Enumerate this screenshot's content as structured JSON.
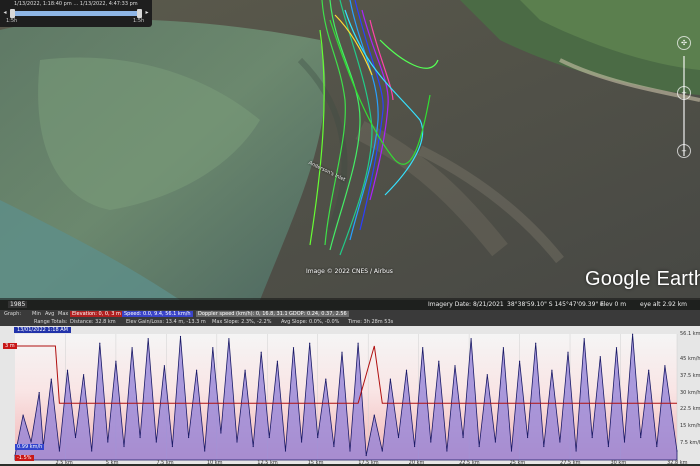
{
  "time_slider": {
    "range_text": "1/13/2022, 1:18:40 pm … 1/13/2022, 4:47:33 pm",
    "start_label": "1:5h",
    "end_label": "1:5h"
  },
  "map": {
    "river_label": "Anderson's Inlet",
    "copyright": "Image © 2022 CNES / Airbus",
    "logo_text": "Google Earth",
    "history_year": "1985"
  },
  "status_bar": {
    "imagery_date": "Imagery Date: 8/21/2021",
    "coords": "38°38'59.10\" S  145°47'09.39\" E",
    "elev": "elev   0 m",
    "eye_alt": "eye alt   2.92 km"
  },
  "profile": {
    "header_row1": {
      "graph": "Graph:",
      "min": "Min",
      "avg": "Avg",
      "max": "Max",
      "elevation": "Elevation: 0, 0, 3 m",
      "speed": "Speed: 0.0, 9.4, 56.1 km/h",
      "doppler": "Doppler speed (km/h): 0, 16.8, 31.1",
      "gdop": "GDOP: 0.24, 0.37, 2.56"
    },
    "header_row2": {
      "range_totals": "Range Totals:",
      "distance": "Distance: 32.8 km",
      "elev_gain": "Elev Gain/Loss: 13.4 m, -13.3 m",
      "max_slope": "Max Slope: 2.3%, -2.2%",
      "avg_slope": "Avg Slope: 0.0%, -0.0%",
      "time": "Time: 3h 28m 53s"
    },
    "date_chip": "13/01/2022 1:18 AM",
    "left_value": "3 m",
    "bottom_left_speed": "0.99 km/h",
    "bottom_left_slope": "-1.5%",
    "x_ticks": [
      "2.5 km",
      "5 km",
      "7.5 km",
      "10 km",
      "12.5 km",
      "15 km",
      "17.5 km",
      "20 km",
      "22.5 km",
      "25 km",
      "27.5 km",
      "30 km",
      "32.8 km"
    ],
    "y_ticks_right": [
      "56.1 km/h",
      "45 km/h",
      "37.5 km/h",
      "30 km/h",
      "22.5 km/h",
      "15 km/h",
      "7.5 km/h"
    ],
    "colors": {
      "elevation_line": "#b01010",
      "speed_fill": "#8f7fd8",
      "speed_line": "#1a1a66",
      "background_top": "#f4f4f4",
      "background_bottom": "#f5c9c9"
    }
  },
  "chart_data": {
    "type": "area",
    "xlabel": "",
    "ylabel": "",
    "xlim": [
      0,
      32.8
    ],
    "ylim": [
      0,
      56.1
    ],
    "series": [
      {
        "name": "Speed",
        "x": [
          0,
          0.4,
          0.8,
          1.2,
          1.4,
          1.8,
          2.2,
          2.6,
          3.0,
          3.4,
          3.8,
          4.2,
          4.6,
          5.0,
          5.4,
          5.8,
          6.2,
          6.6,
          7.0,
          7.4,
          7.8,
          8.2,
          8.6,
          9.0,
          9.4,
          9.8,
          10.2,
          10.6,
          11.0,
          11.4,
          11.8,
          12.2,
          12.6,
          13.0,
          13.4,
          13.8,
          14.2,
          14.6,
          15.0,
          15.4,
          15.8,
          16.2,
          16.6,
          17.0,
          17.4,
          17.8,
          18.2,
          18.6,
          19.0,
          19.4,
          19.8,
          20.2,
          20.6,
          21.0,
          21.4,
          21.8,
          22.2,
          22.6,
          23.0,
          23.4,
          23.8,
          24.2,
          24.6,
          25.0,
          25.4,
          25.8,
          26.2,
          26.6,
          27.0,
          27.4,
          27.8,
          28.2,
          28.6,
          29.0,
          29.4,
          29.8,
          30.2,
          30.6,
          31.0,
          31.4,
          31.8,
          32.2,
          32.8
        ],
        "values": [
          2,
          20,
          8,
          30,
          6,
          36,
          4,
          40,
          10,
          38,
          4,
          52,
          8,
          44,
          6,
          50,
          10,
          54,
          8,
          42,
          6,
          55,
          10,
          40,
          4,
          50,
          12,
          54,
          8,
          40,
          6,
          48,
          10,
          44,
          4,
          50,
          8,
          52,
          10,
          36,
          6,
          48,
          4,
          52,
          2,
          20,
          4,
          36,
          10,
          40,
          6,
          50,
          8,
          44,
          4,
          42,
          10,
          54,
          6,
          38,
          8,
          50,
          4,
          44,
          10,
          52,
          6,
          40,
          8,
          48,
          4,
          54,
          10,
          46,
          6,
          50,
          8,
          56,
          10,
          40,
          6,
          42,
          4
        ]
      },
      {
        "name": "Elevation",
        "x": [
          0,
          1.0,
          2.0,
          2.2,
          4.0,
          7.0,
          10.0,
          12.5,
          17.0,
          17.8,
          18.2,
          20.0,
          25.0,
          30.0,
          32.8
        ],
        "values": [
          3,
          3,
          3,
          1,
          1,
          1,
          1,
          1,
          1,
          3,
          1,
          1,
          1,
          1,
          1
        ]
      }
    ]
  }
}
